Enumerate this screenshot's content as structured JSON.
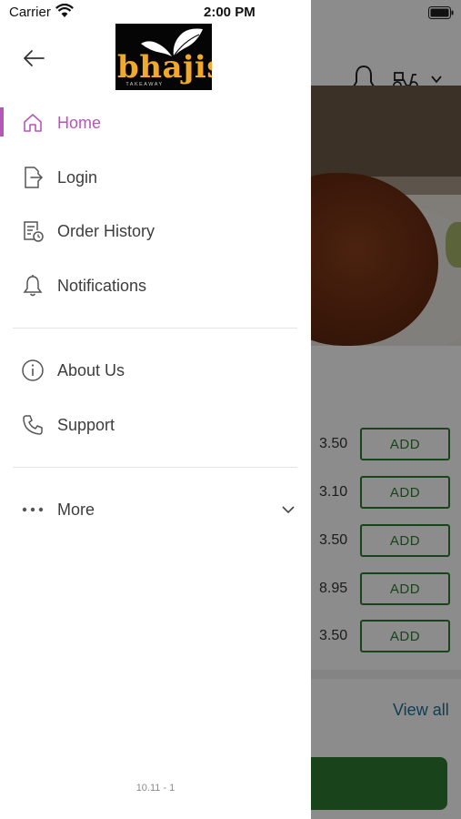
{
  "status_bar": {
    "carrier": "Carrier",
    "time": "2:00 PM"
  },
  "brand": {
    "logo_text": "bhajis",
    "logo_subtext": "TAKEAWAY",
    "accent_color": "#b656b8"
  },
  "menu": {
    "items": [
      {
        "label": "Home",
        "icon": "home-icon",
        "active": true
      },
      {
        "label": "Login",
        "icon": "login-icon",
        "active": false
      },
      {
        "label": "Order History",
        "icon": "order-history-icon",
        "active": false
      },
      {
        "label": "Notifications",
        "icon": "bell-icon",
        "active": false
      }
    ],
    "secondary_items": [
      {
        "label": "About Us",
        "icon": "info-icon"
      },
      {
        "label": "Support",
        "icon": "phone-icon"
      }
    ],
    "more": {
      "label": "More",
      "icon": "more-dots-icon"
    }
  },
  "version": "10.11 - 1",
  "background_app": {
    "products": [
      {
        "price": "3.50",
        "button": "ADD"
      },
      {
        "price": "3.10",
        "button": "ADD"
      },
      {
        "price": "3.50",
        "button": "ADD"
      },
      {
        "price": "8.95",
        "button": "ADD"
      },
      {
        "price": "3.50",
        "button": "ADD"
      }
    ],
    "view_all": "View all",
    "button_color": "#2e7d32",
    "link_color": "#1c6f98"
  }
}
